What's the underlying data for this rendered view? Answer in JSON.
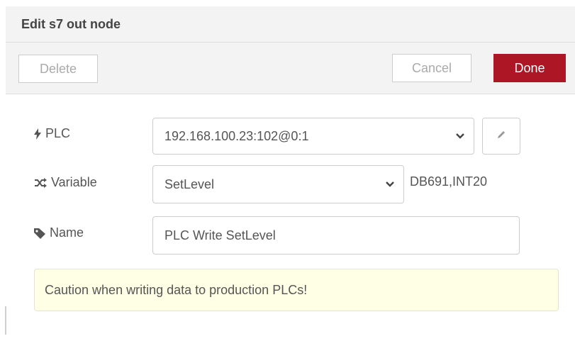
{
  "dialog": {
    "title": "Edit s7 out node"
  },
  "toolbar": {
    "delete_label": "Delete",
    "cancel_label": "Cancel",
    "done_label": "Done"
  },
  "form": {
    "plc": {
      "label": "PLC",
      "icon": "bolt-icon",
      "selected": "192.168.100.23:102@0:1"
    },
    "variable": {
      "label": "Variable",
      "icon": "random-icon",
      "selected": "SetLevel",
      "address": "DB691,INT20"
    },
    "name": {
      "label": "Name",
      "icon": "tag-icon",
      "value": "PLC Write SetLevel"
    }
  },
  "tip": {
    "text": "Caution when writing data to production PLCs!"
  },
  "colors": {
    "done_bg": "#ad1625",
    "header_bg": "#f3f3f3",
    "tip_bg": "#ffffe6"
  }
}
